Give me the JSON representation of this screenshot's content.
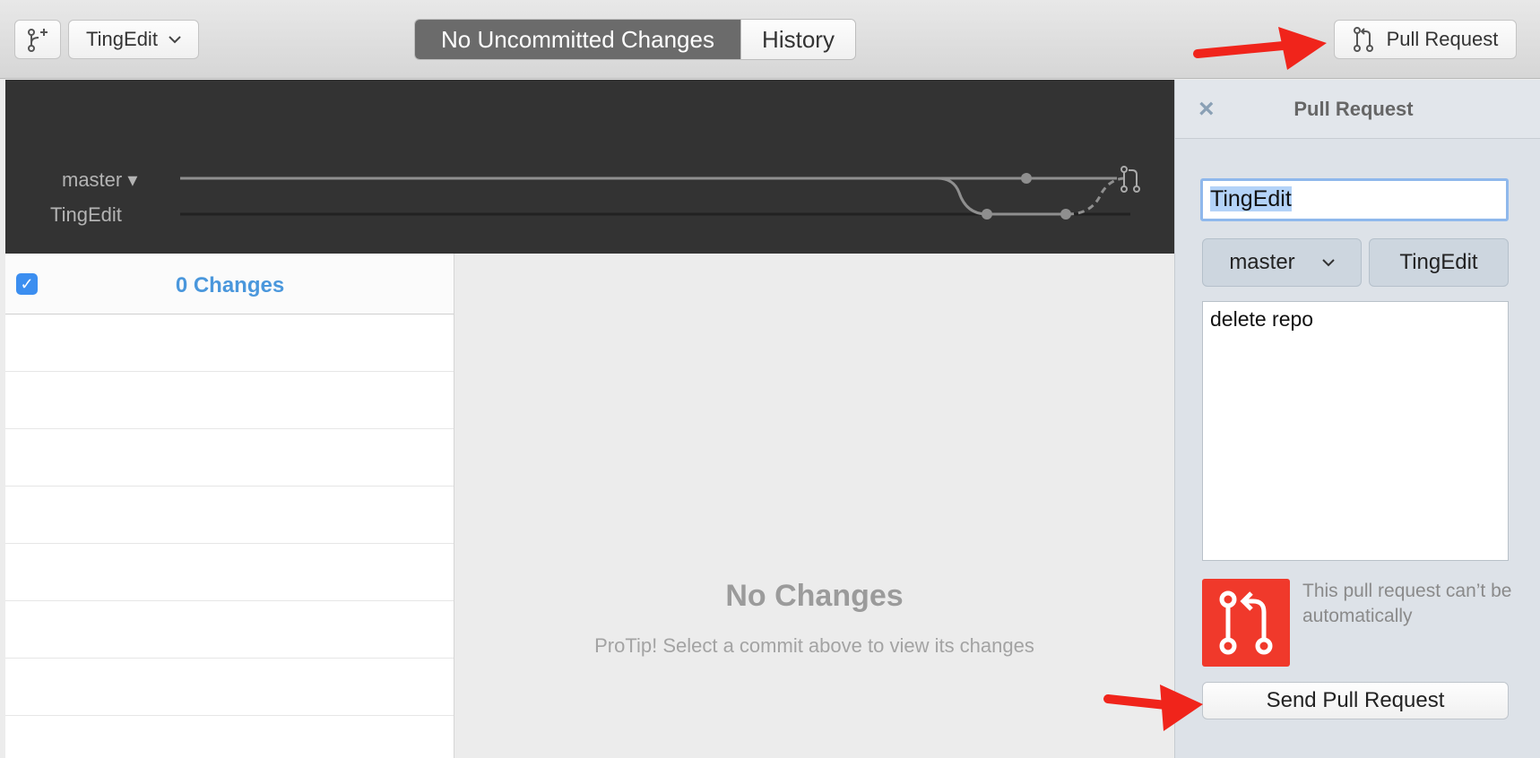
{
  "toolbar": {
    "branch_name": "TingEdit",
    "segments": [
      "No Uncommitted Changes",
      "History"
    ],
    "pull_request_label": "Pull Request"
  },
  "graph": {
    "branches": [
      "master",
      "TingEdit"
    ]
  },
  "changes": {
    "count_label": "0 Changes"
  },
  "diff": {
    "empty_title": "No Changes",
    "protip": "ProTip! Select a commit above to view its changes"
  },
  "pull_request_panel": {
    "title": "Pull Request",
    "title_value": "TingEdit",
    "base_branch": "master",
    "head_branch": "TingEdit",
    "body_value": "delete repo",
    "warning": "This pull request can’t be automatically",
    "send_label": "Send Pull Request"
  },
  "colors": {
    "accent_blue": "#4a97dc",
    "warning_red": "#f0392b",
    "annotation_arrow": "#f0241b"
  }
}
